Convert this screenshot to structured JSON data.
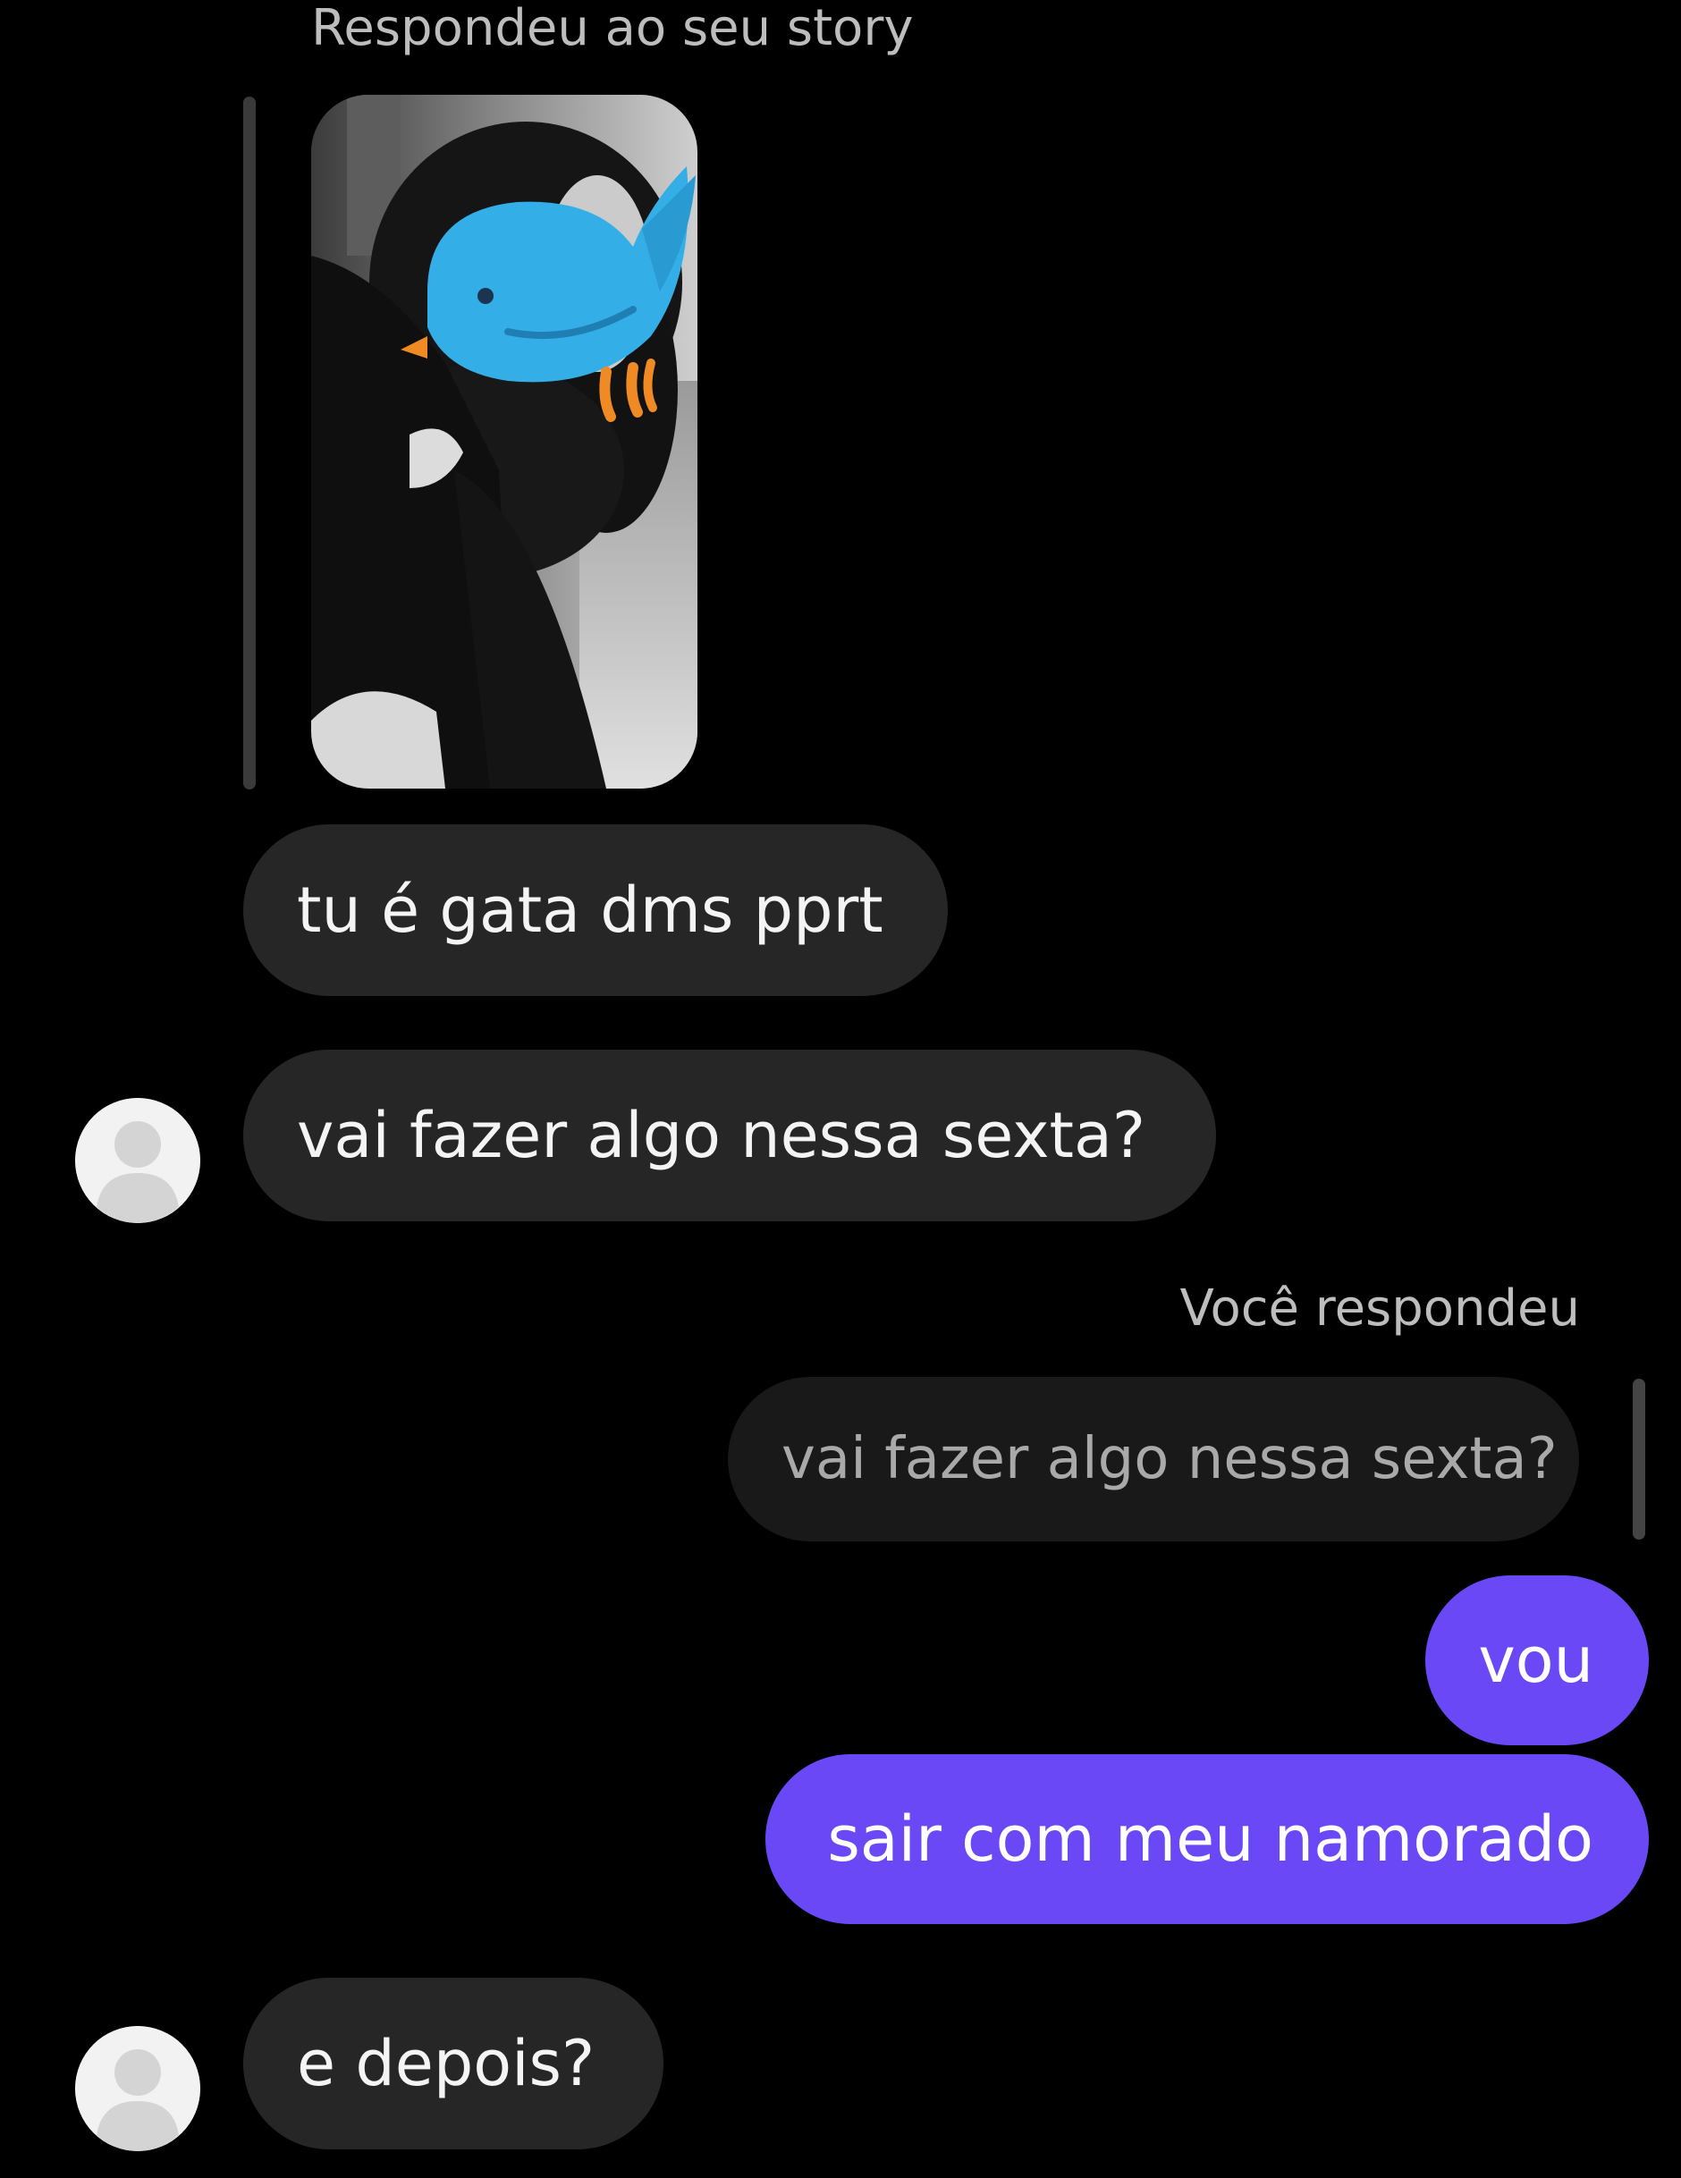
{
  "colors": {
    "background": "#000000",
    "incoming_bubble": "#262626",
    "quoted_bubble": "#191919",
    "outgoing_bubble": "#6a48f5",
    "label_text": "#bdbdbd",
    "story_sticker": "#33aee6"
  },
  "thread": {
    "story_reply": {
      "label": "Respondeu ao seu story",
      "thumbnail_icon": "story-photo-with-bird-sticker"
    },
    "messages": [
      {
        "id": "m1",
        "direction": "incoming",
        "text": "tu é gata dms pprt"
      },
      {
        "id": "m2",
        "direction": "incoming",
        "text": "vai fazer algo nessa sexta?",
        "avatar": "default-user-avatar"
      }
    ],
    "you_replied": {
      "label": "Você respondeu",
      "quoted_text": "vai fazer algo nessa sexta?"
    },
    "outgoing": [
      {
        "id": "m3",
        "direction": "outgoing",
        "text": "vou"
      },
      {
        "id": "m4",
        "direction": "outgoing",
        "text": "sair com meu namorado"
      }
    ],
    "last_incoming": {
      "id": "m5",
      "direction": "incoming",
      "text": "e depois?",
      "avatar": "default-user-avatar"
    }
  }
}
